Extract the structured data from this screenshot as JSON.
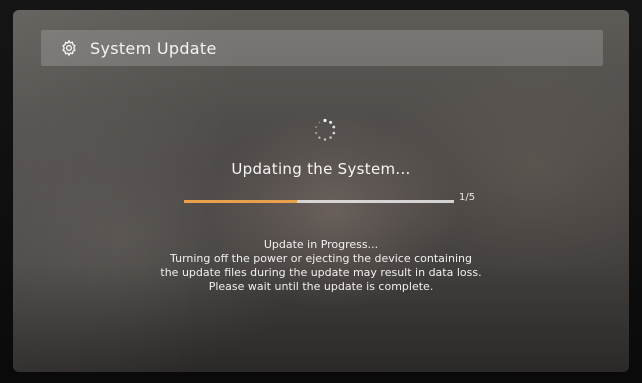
{
  "header": {
    "icon": "gear-icon",
    "title": "System Update"
  },
  "status": {
    "spinner_icon": "loading-spinner-icon",
    "title": "Updating the System..."
  },
  "progress": {
    "fraction": 0.42,
    "step_label": "1/5",
    "fill_color": "#e9a04c",
    "track_color": "#ebebeb"
  },
  "message": {
    "lines": [
      "Update in Progress...",
      "Turning off the power or ejecting the device containing",
      "the update files during the update may result in data loss.",
      "Please wait until the update is complete."
    ]
  }
}
